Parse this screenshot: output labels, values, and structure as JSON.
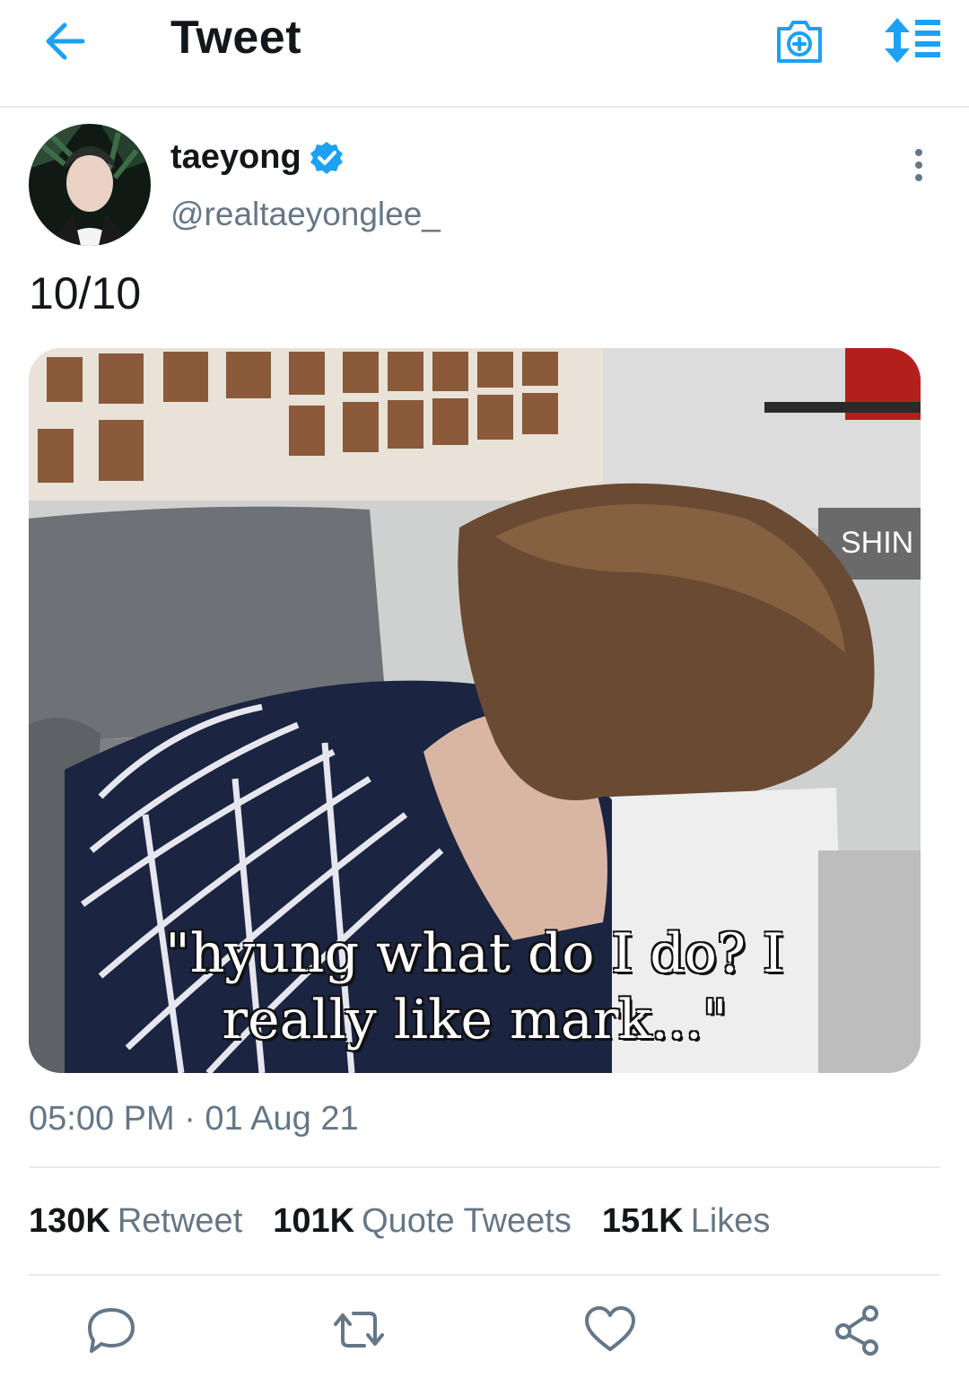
{
  "header": {
    "title": "Tweet"
  },
  "tweet": {
    "author_name": "taeyong",
    "author_handle": "@realtaeyonglee_",
    "text": "10/10",
    "media_caption": "\"hyung what do I do? I really like mark...\"",
    "timestamp": "05:00 PM · 01 Aug 21"
  },
  "stats": [
    {
      "count": "130K",
      "label": "Retweet"
    },
    {
      "count": "101K",
      "label": "Quote Tweets"
    },
    {
      "count": "151K",
      "label": "Likes"
    }
  ],
  "icons": {
    "back": "arrow-left-icon",
    "camera": "camera-add-icon",
    "sort": "sort-icon",
    "verified": "verified-badge-icon",
    "more": "more-vertical-icon",
    "reply": "reply-icon",
    "retweet": "retweet-icon",
    "like": "heart-icon",
    "share": "share-icon"
  },
  "colors": {
    "accent": "#1da1f2",
    "secondary_text": "#657786",
    "divider": "#e6ecf0"
  }
}
